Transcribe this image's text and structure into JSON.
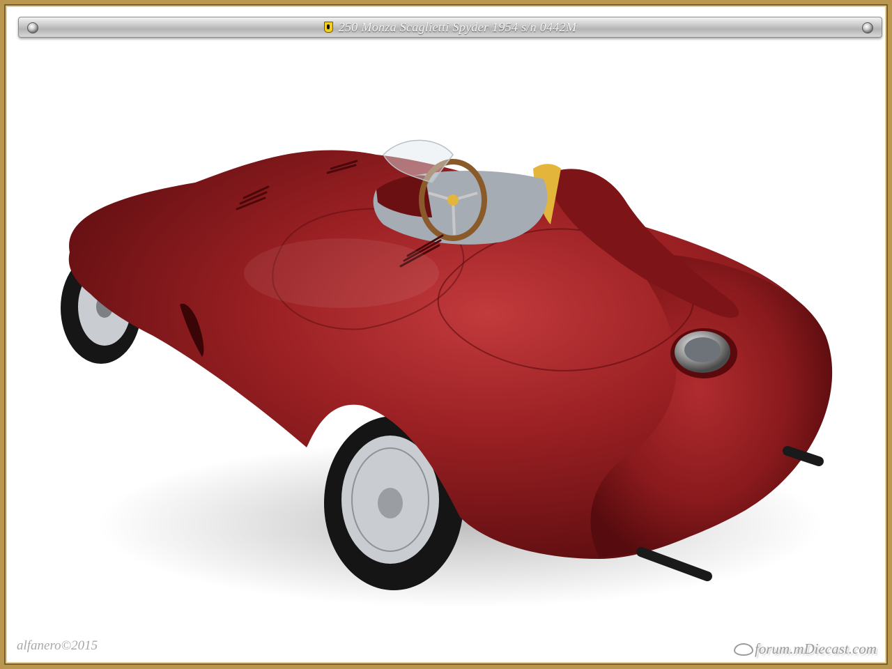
{
  "header": {
    "title": "250 Monza Scaglietti Spyder 1954  s/n 0442M",
    "left_screw_icon": "screw-icon",
    "right_screw_icon": "screw-icon",
    "badge_icon": "prancing-horse-shield-icon"
  },
  "photo": {
    "car_color": "#8e1b1f",
    "seat_color": "#a5acb4",
    "headrest_accent": "#e3b53a",
    "wheel_color": "#c9ccd0"
  },
  "watermark": {
    "copyright": "alfanero©2015"
  },
  "site": {
    "name": "forum.mDiecast.com",
    "logo_icon": "forum-logo-icon"
  },
  "colors": {
    "frame_gold": "#b9974f",
    "title_text": "#f4f4f4"
  }
}
